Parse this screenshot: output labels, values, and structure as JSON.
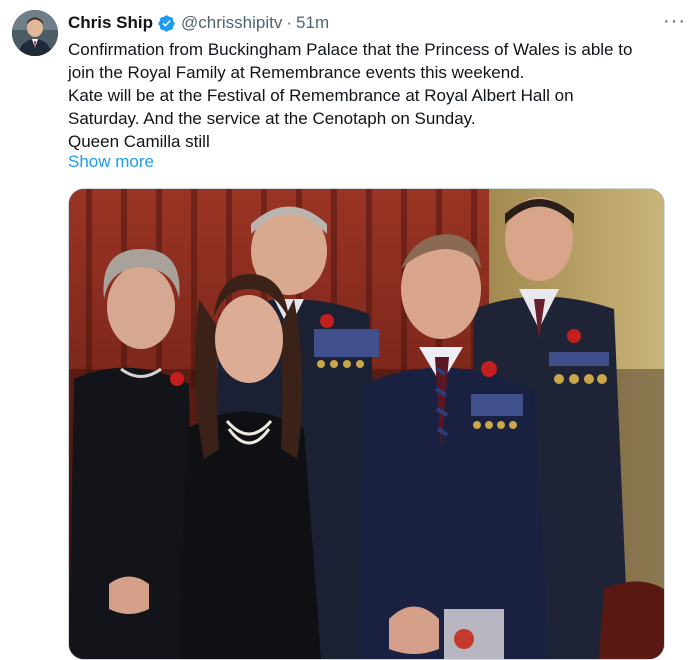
{
  "author": {
    "name": "Chris Ship",
    "handle": "@chrisshipitv",
    "separator": "·",
    "time": "51m",
    "verified": true,
    "avatar_icon": "profile-photo"
  },
  "menu_icon": "more-horizontal-icon",
  "more_label": "···",
  "tweet": {
    "lines": [
      "Confirmation from Buckingham Palace that the Princess of Wales is able to",
      "join the Royal Family at Remembrance events this weekend.",
      "Kate will be at the Festival of Remembrance at Royal Albert Hall on",
      "Saturday. And the service at the Cenotaph on Sunday.",
      "Queen Camilla still"
    ],
    "show_more": "Show more"
  },
  "media": {
    "type": "photo"
  },
  "colors": {
    "link": "#1d9bf0",
    "verified": "#1d9bf0",
    "secondary_text": "#536471"
  }
}
